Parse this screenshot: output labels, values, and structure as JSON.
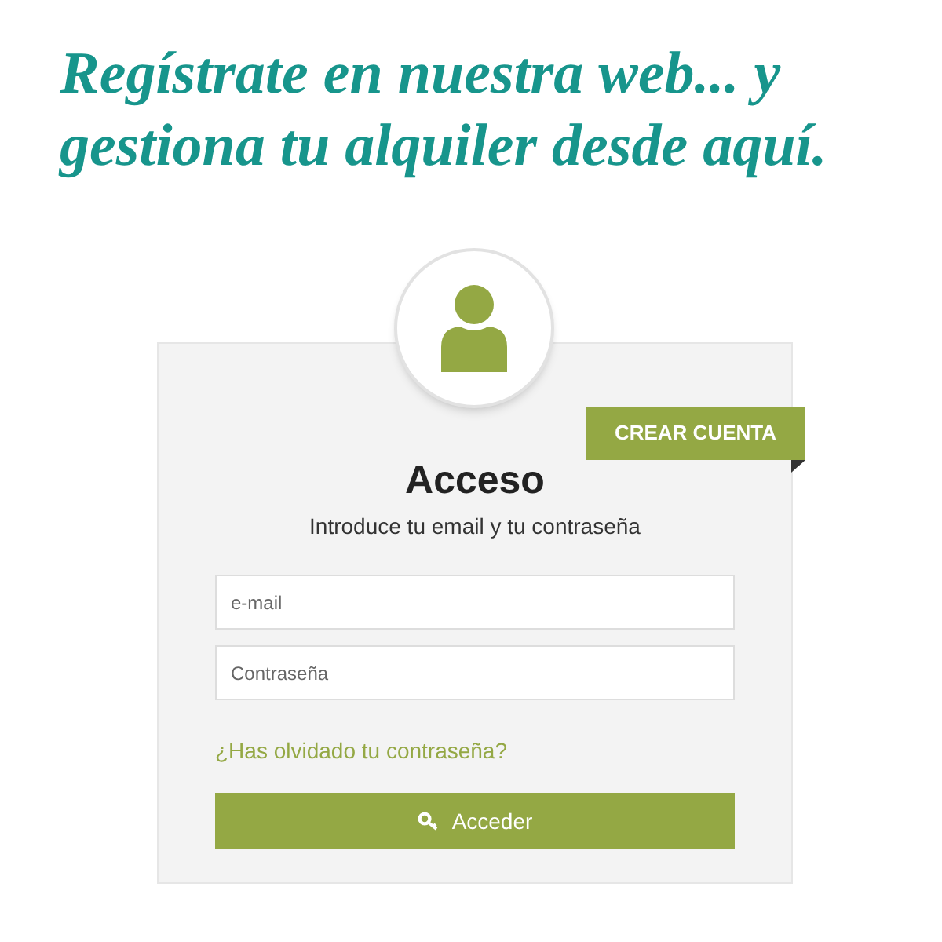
{
  "headline": [
    "Regístrate en nuestra web... y",
    "gestiona tu alquiler desde aquí."
  ],
  "card": {
    "ribbon": "CREAR CUENTA",
    "title": "Acceso",
    "subtitle": "Introduce tu email y tu contraseña",
    "fields": [
      {
        "placeholder": "e-mail"
      },
      {
        "placeholder": "Contraseña"
      }
    ],
    "forgot_link": "¿Has olvidado tu contraseña?",
    "submit": "Acceder"
  }
}
